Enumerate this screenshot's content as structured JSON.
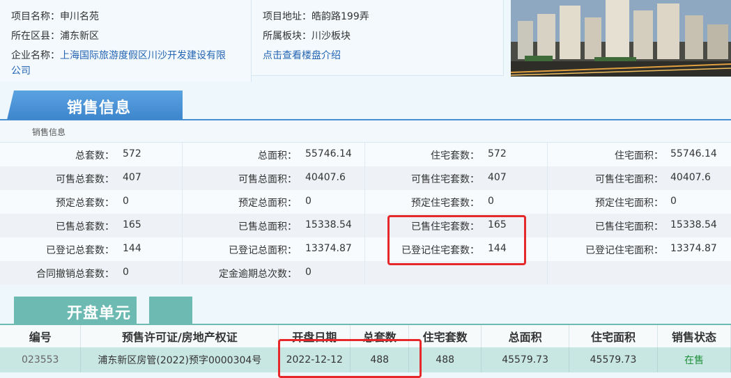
{
  "project": {
    "name_label": "项目名称：",
    "name_value": "申川名苑",
    "district_label": "所在区县：",
    "district_value": "浦东新区",
    "company_label": "企业名称：",
    "company_value_line1": "上海国际旅游度假区川沙开发建设有限",
    "company_value_line2": "公司",
    "address_label": "项目地址：",
    "address_value": "皓韵路199弄",
    "block_label": "所属板块：",
    "block_value": "川沙板块",
    "intro_link": "点击查看楼盘介绍"
  },
  "sales_section": {
    "title": "销售信息",
    "subheader": "销售信息",
    "rows": [
      [
        {
          "k": "总套数：",
          "v": "572"
        },
        {
          "k": "总面积：",
          "v": "55746.14"
        },
        {
          "k": "住宅套数：",
          "v": "572"
        },
        {
          "k": "住宅面积：",
          "v": "55746.14"
        }
      ],
      [
        {
          "k": "可售总套数：",
          "v": "407"
        },
        {
          "k": "可售总面积：",
          "v": "40407.6"
        },
        {
          "k": "可售住宅套数：",
          "v": "407"
        },
        {
          "k": "可售住宅面积：",
          "v": "40407.6"
        }
      ],
      [
        {
          "k": "预定总套数：",
          "v": "0"
        },
        {
          "k": "预定总面积：",
          "v": "0"
        },
        {
          "k": "预定住宅套数：",
          "v": "0"
        },
        {
          "k": "预定住宅面积：",
          "v": "0"
        }
      ],
      [
        {
          "k": "已售总套数：",
          "v": "165"
        },
        {
          "k": "已售总面积：",
          "v": "15338.54"
        },
        {
          "k": "已售住宅套数：",
          "v": "165"
        },
        {
          "k": "已售住宅面积：",
          "v": "15338.54"
        }
      ],
      [
        {
          "k": "已登记总套数：",
          "v": "144"
        },
        {
          "k": "已登记总面积：",
          "v": "13374.87"
        },
        {
          "k": "已登记住宅套数：",
          "v": "144"
        },
        {
          "k": "已登记住宅面积：",
          "v": "13374.87"
        }
      ],
      [
        {
          "k": "合同撤销总套数：",
          "v": "0"
        },
        {
          "k": "定金逾期总次数：",
          "v": "0"
        },
        {
          "k": "",
          "v": ""
        },
        {
          "k": "",
          "v": ""
        }
      ]
    ]
  },
  "opening_section": {
    "title": "开盘单元",
    "headers": [
      "编号",
      "预售许可证/房地产权证",
      "开盘日期",
      "总套数",
      "住宅套数",
      "总面积",
      "住宅面积",
      "销售状态"
    ],
    "rows": [
      [
        "023553",
        "浦东新区房管(2022)预字0000304号",
        "2022-12-12",
        "488",
        "488",
        "45579.73",
        "45579.73",
        "在售"
      ]
    ]
  },
  "colors": {
    "sales_tab": "#4a90d0",
    "opening_tab": "#6dbab2",
    "highlight": "#e6282a",
    "link": "#2565b3",
    "status_on_sale": "#1f8f3a"
  }
}
